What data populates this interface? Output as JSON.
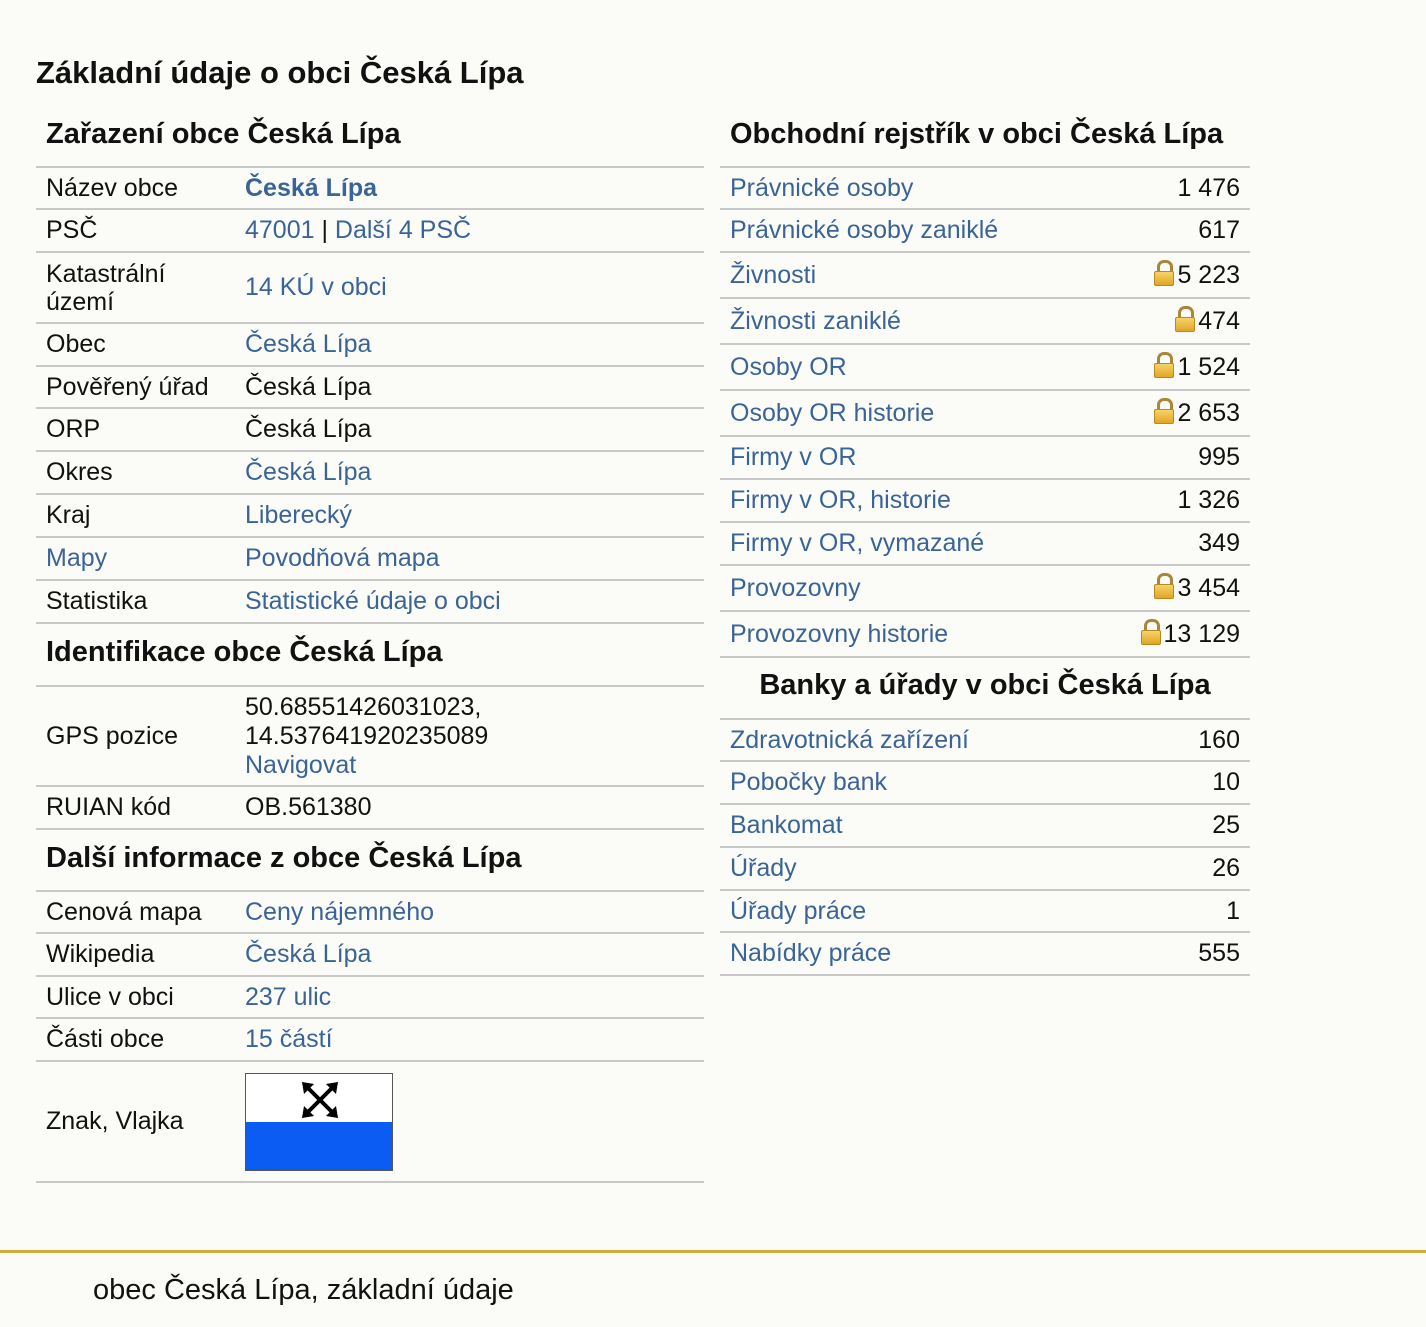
{
  "page_title": "Základní údaje o obci Česká Lípa",
  "zarazeni": {
    "title": "Zařazení obce Česká Lípa",
    "nazev_label": "Název obce",
    "nazev_value": "Česká Lípa",
    "psc_label": "PSČ",
    "psc_value": "47001",
    "psc_sep": " | ",
    "psc_more": "Další 4 PSČ",
    "katastr_label": "Katastrální území",
    "katastr_value": "14 KÚ v obci",
    "obec_label": "Obec",
    "obec_value": "Česká Lípa",
    "poverenу_label": "Pověřený úřad",
    "povereny_value": "Česká Lípa",
    "orp_label": "ORP",
    "orp_value": "Česká Lípa",
    "okres_label": "Okres",
    "okres_value": "Česká Lípa",
    "kraj_label": "Kraj",
    "kraj_value": "Liberecký",
    "mapy_label": "Mapy",
    "mapy_value": "Povodňová mapa",
    "statistika_label": "Statistika",
    "statistika_value": "Statistické údaje o obci"
  },
  "identifikace": {
    "title": "Identifikace obce Česká Lípa",
    "gps_label": "GPS pozice",
    "gps_lat": "50.68551426031023,",
    "gps_lon": "14.537641920235089",
    "gps_nav": "Navigovat",
    "ruian_label": "RUIAN kód",
    "ruian_value": "OB.561380"
  },
  "dalsi": {
    "title": "Další informace z obce Česká Lípa",
    "cenova_label": "Cenová mapa",
    "cenova_value": "Ceny nájemného",
    "wiki_label": "Wikipedia",
    "wiki_value": "Česká Lípa",
    "ulice_label": "Ulice v obci",
    "ulice_value": "237 ulic",
    "casti_label": "Části obce",
    "casti_value": "15 částí",
    "znak_label": "Znak, Vlajka"
  },
  "rejstrik": {
    "title": "Obchodní rejstřík v obci Česká Lípa",
    "rows": [
      {
        "label": "Právnické osoby",
        "value": "1 476",
        "locked": false
      },
      {
        "label": "Právnické osoby zaniklé",
        "value": "617",
        "locked": false
      },
      {
        "label": "Živnosti",
        "value": "5 223",
        "locked": true
      },
      {
        "label": "Živnosti zaniklé",
        "value": "474",
        "locked": true
      },
      {
        "label": "Osoby OR",
        "value": "1 524",
        "locked": true
      },
      {
        "label": "Osoby OR historie",
        "value": "2 653",
        "locked": true
      },
      {
        "label": "Firmy v OR",
        "value": "995",
        "locked": false
      },
      {
        "label": "Firmy v OR, historie",
        "value": "1 326",
        "locked": false
      },
      {
        "label": "Firmy v OR, vymazané",
        "value": "349",
        "locked": false
      },
      {
        "label": "Provozovny",
        "value": "3 454",
        "locked": true
      },
      {
        "label": "Provozovny historie",
        "value": "13 129",
        "locked": true
      }
    ]
  },
  "banky": {
    "title": "Banky a úřady v obci Česká Lípa",
    "rows": [
      {
        "label": "Zdravotnická zařízení",
        "value": "160"
      },
      {
        "label": "Pobočky bank",
        "value": "10"
      },
      {
        "label": "Bankomat",
        "value": "25"
      },
      {
        "label": "Úřady",
        "value": "26"
      },
      {
        "label": "Úřady práce",
        "value": "1"
      },
      {
        "label": "Nabídky práce",
        "value": "555"
      }
    ]
  },
  "colors": {
    "link": "#3a6496",
    "footer_border": "#d3ad3a",
    "flag_blue": "#0a5cf2"
  },
  "footer": {
    "text": "obec Česká Lípa, základní údaje"
  }
}
